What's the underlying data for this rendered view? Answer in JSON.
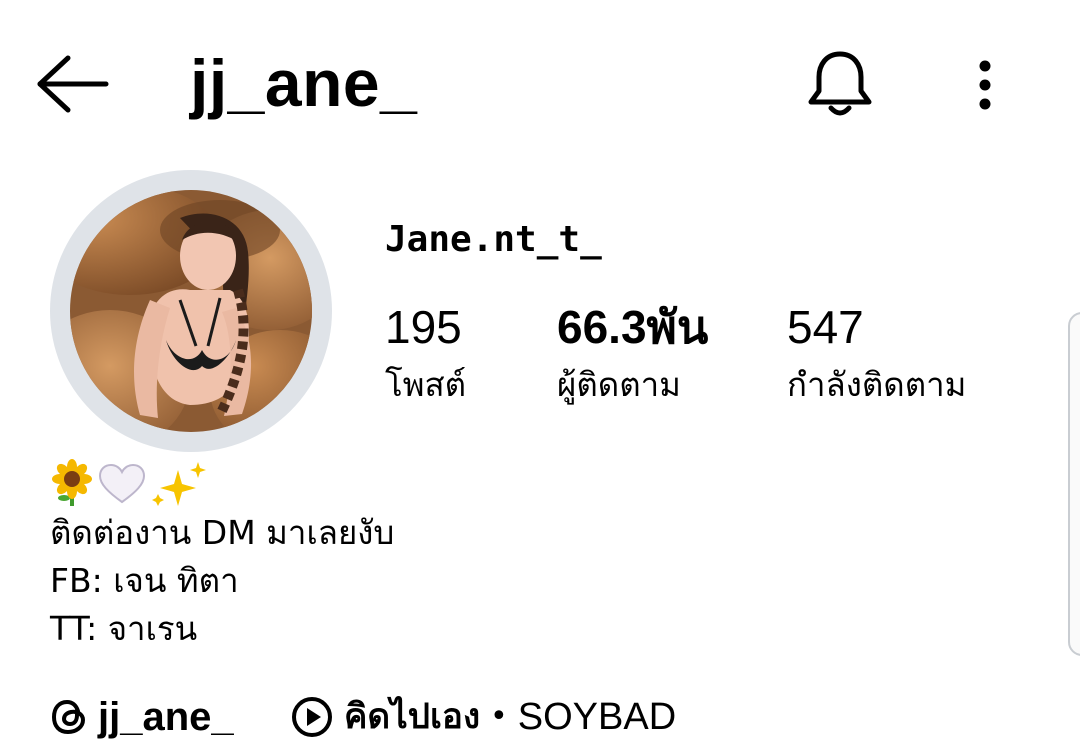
{
  "header": {
    "username": "jj_ane_",
    "back_icon": "arrow-left-icon",
    "bell_icon": "bell-icon",
    "more_icon": "more-vertical-icon"
  },
  "profile": {
    "display_name": "Jane.nt_t_",
    "avatar_alt": "profile photo",
    "stats": {
      "posts": {
        "value": "195",
        "label": "โพสต์"
      },
      "followers": {
        "value": "66.3พัน",
        "label": "ผู้ติดตาม"
      },
      "following": {
        "value": "547",
        "label": "กำลังติดตาม"
      }
    }
  },
  "bio": {
    "emoji": [
      "sunflower",
      "white-heart",
      "sparkles"
    ],
    "lines": [
      "ติดต่องาน DM มาเลยงับ",
      "FB: เจน ทิตา",
      "TT: จาเรน"
    ]
  },
  "links": {
    "threads_handle": "jj_ane_",
    "threads_icon": "threads-icon",
    "song_title": "คิดไปเอง",
    "separator": "•",
    "artist": "SOYBAD",
    "play_icon": "play-circle-icon"
  },
  "colors": {
    "background": "#ffffff",
    "text": "#000000",
    "avatar_ring": "#dfe3e8"
  }
}
